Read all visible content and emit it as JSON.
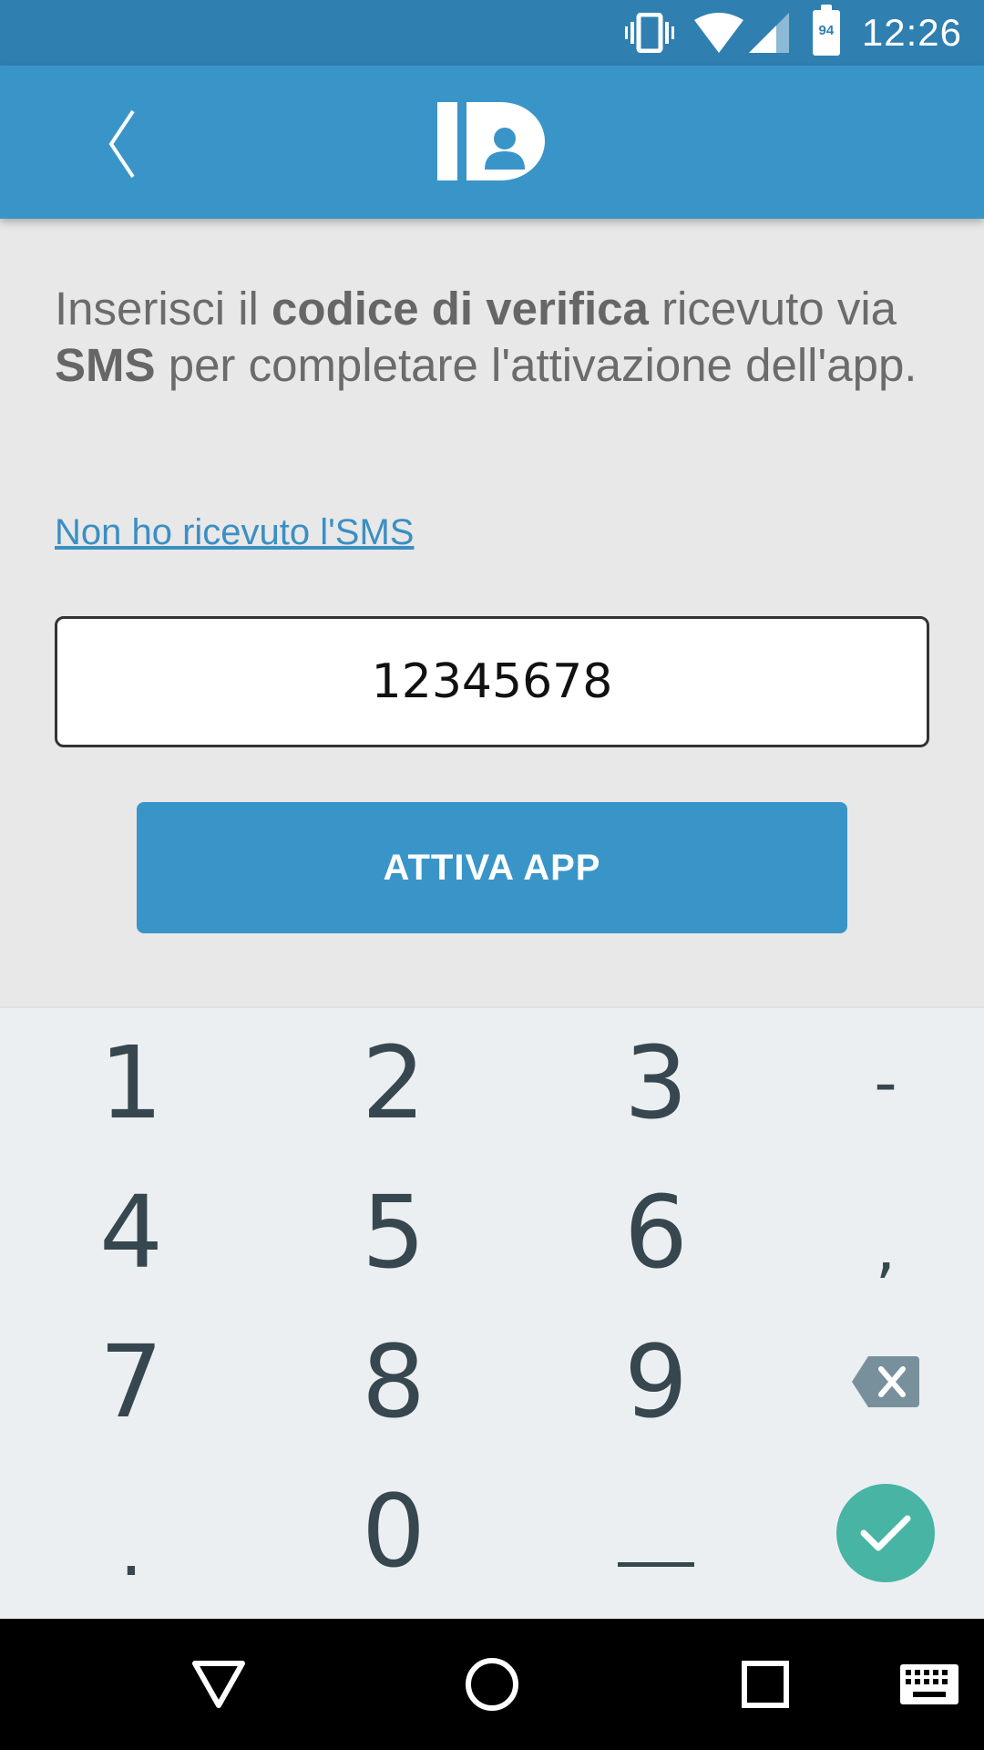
{
  "status_bar": {
    "time": "12:26",
    "battery_level": "94",
    "icons": [
      "vibrate-icon",
      "wifi-icon",
      "signal-icon",
      "battery-icon"
    ]
  },
  "app_bar": {
    "logo_text": "ID",
    "back_icon": "chevron-left-icon"
  },
  "content": {
    "instruction_parts": {
      "p1": "Inserisci il ",
      "b1": "codice di verifica",
      "p2": " ricevuto via ",
      "b2": "SMS",
      "p3": " per completare l'attivazione dell'app."
    },
    "sms_link": "Non ho ricevuto l'SMS",
    "code_value": "12345678",
    "activate_button": "ATTIVA APP"
  },
  "keypad": {
    "keys": [
      "1",
      "2",
      "3",
      "-",
      "4",
      "5",
      "6",
      ",",
      "7",
      "8",
      "9",
      "backspace",
      ".",
      "0",
      "_",
      "done"
    ],
    "k1": "1",
    "k2": "2",
    "k3": "3",
    "kdash": "-",
    "k4": "4",
    "k5": "5",
    "k6": "6",
    "kcomma": ",",
    "k7": "7",
    "k8": "8",
    "k9": "9",
    "kdot": ".",
    "k0": "0"
  },
  "colors": {
    "status_bar": "#2f80b0",
    "app_bar": "#3995c8",
    "accent": "#3995c8",
    "done_key": "#47b4a4",
    "background": "#e8e8e8",
    "keypad_bg": "#eceff1"
  }
}
